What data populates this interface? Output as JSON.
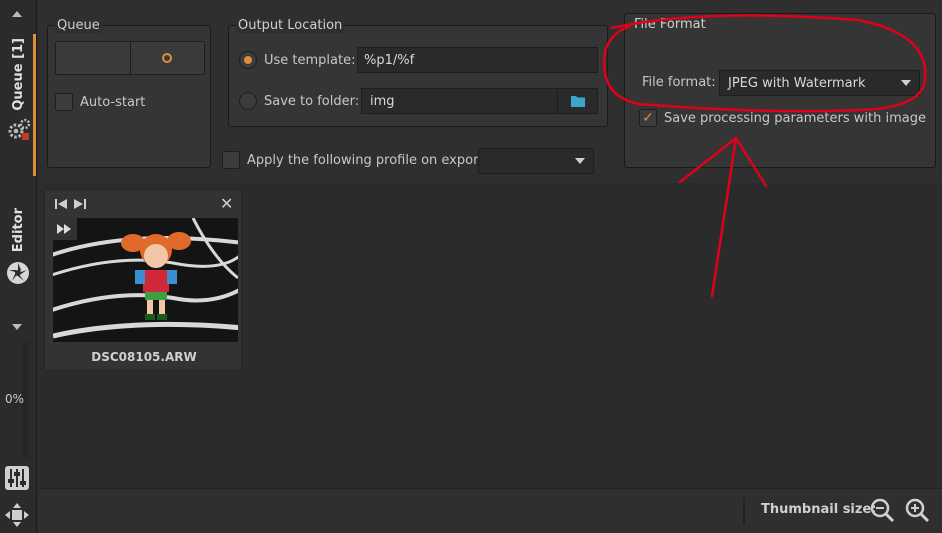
{
  "sidebar": {
    "queue_tab_label": "Queue [1]",
    "editor_tab_label": "Editor",
    "progress_percent": "0%"
  },
  "queue_panel": {
    "title": "Queue",
    "auto_start_label": "Auto-start",
    "auto_start_checked": false
  },
  "output_panel": {
    "title": "Output Location",
    "use_template_label": "Use template:",
    "template_value": "%p1/%f",
    "save_to_folder_label": "Save to folder:",
    "folder_value": "img",
    "selected_option": "use_template"
  },
  "profile": {
    "label": "Apply the following profile on export:",
    "checked": false,
    "value": ""
  },
  "file_format_panel": {
    "title": "File Format",
    "format_label": "File format:",
    "format_value": "JPEG with Watermark",
    "save_params_label": "Save processing parameters with image",
    "save_params_checked": true
  },
  "queue_items": [
    {
      "filename": "DSC08105.ARW"
    }
  ],
  "statusbar": {
    "thumbnail_size_label": "Thumbnail size:"
  },
  "colors": {
    "accent": "#e08e3a",
    "folder_icon": "#3aa6c9",
    "annotation": "#e0001a"
  }
}
